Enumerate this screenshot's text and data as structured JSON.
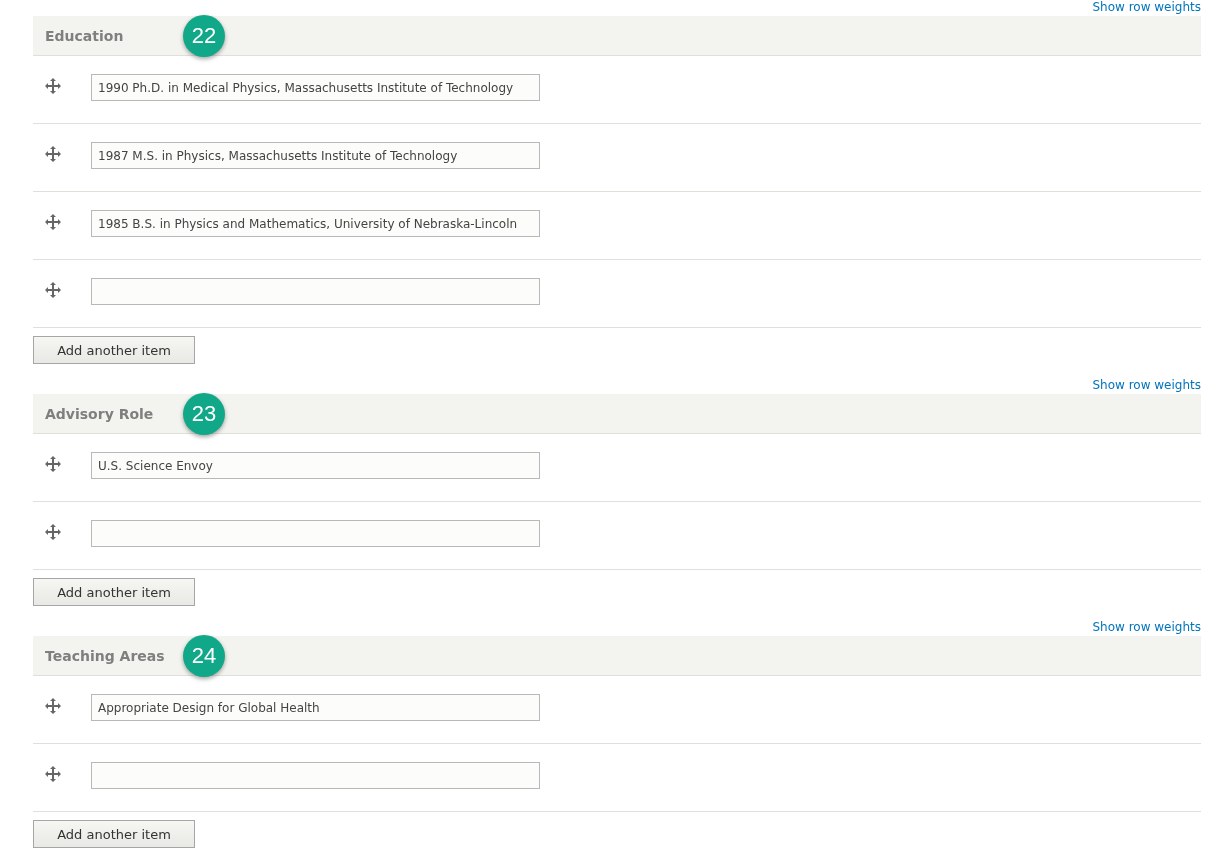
{
  "sections": [
    {
      "weights_link": "Show row weights",
      "title": "Education",
      "badge": "22",
      "items": [
        {
          "kind": "filled",
          "value": "1990 Ph.D. in Medical Physics, Massachusetts Institute of Technology"
        },
        {
          "kind": "filled",
          "value": "1987 M.S. in Physics, Massachusetts Institute of Technology"
        },
        {
          "kind": "filled",
          "value": "1985 B.S. in Physics and Mathematics, University of Nebraska-Lincoln"
        },
        {
          "kind": "blank"
        }
      ],
      "add_button": "Add another item"
    },
    {
      "weights_link": "Show row weights",
      "title": "Advisory Role",
      "badge": "23",
      "items": [
        {
          "kind": "filled",
          "value": "U.S. Science Envoy"
        },
        {
          "kind": "blank"
        }
      ],
      "add_button": "Add another item"
    },
    {
      "weights_link": "Show row weights",
      "title": "Teaching Areas",
      "badge": "24",
      "items": [
        {
          "kind": "filled",
          "value": "Appropriate Design for Global Health"
        },
        {
          "kind": "blank"
        }
      ],
      "add_button": "Add another item"
    }
  ]
}
